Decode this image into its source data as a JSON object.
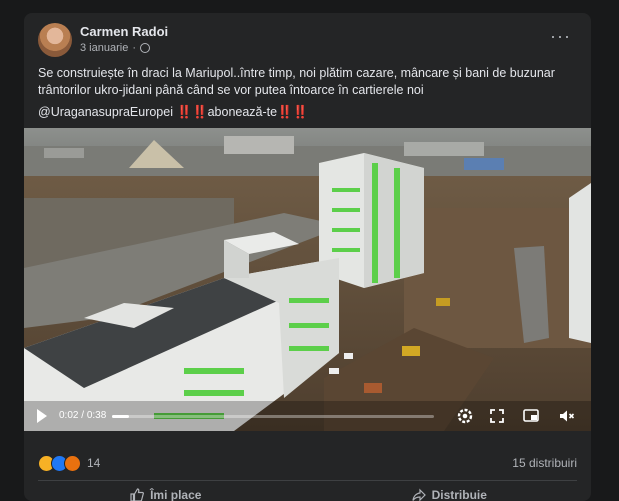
{
  "post": {
    "author": "Carmen Radoi",
    "date": "3 ianuarie",
    "more_label": "···",
    "text_lines": [
      "Se construiește în draci la Mariupol..între timp, noi plătim cazare, mâncare și bani de buzunar trântorilor ukro-jidani până când se vor putea întoarce în cartierele noi",
      "@UraganasupraEuropei ‼️‼️abonează-te‼️‼️"
    ]
  },
  "video": {
    "current_time": "0:02",
    "duration": "0:38",
    "progress_fraction": 0.053
  },
  "footer": {
    "reaction_count": "14",
    "shares": "15 distribuiri",
    "like_label": "Îmi place",
    "share_label": "Distribuie"
  },
  "colors": {
    "background": "#18191a",
    "card": "#242526",
    "text_primary": "#e4e6eb",
    "text_secondary": "#b0b3b8",
    "building_accent": "#5ccf4a"
  },
  "icons": [
    "globe-icon",
    "more-options-icon",
    "play-icon",
    "settings-icon",
    "fullscreen-icon",
    "picture-in-picture-icon",
    "mute-icon",
    "wow-reaction-icon",
    "like-reaction-icon",
    "angry-reaction-icon",
    "like-icon",
    "share-icon"
  ]
}
